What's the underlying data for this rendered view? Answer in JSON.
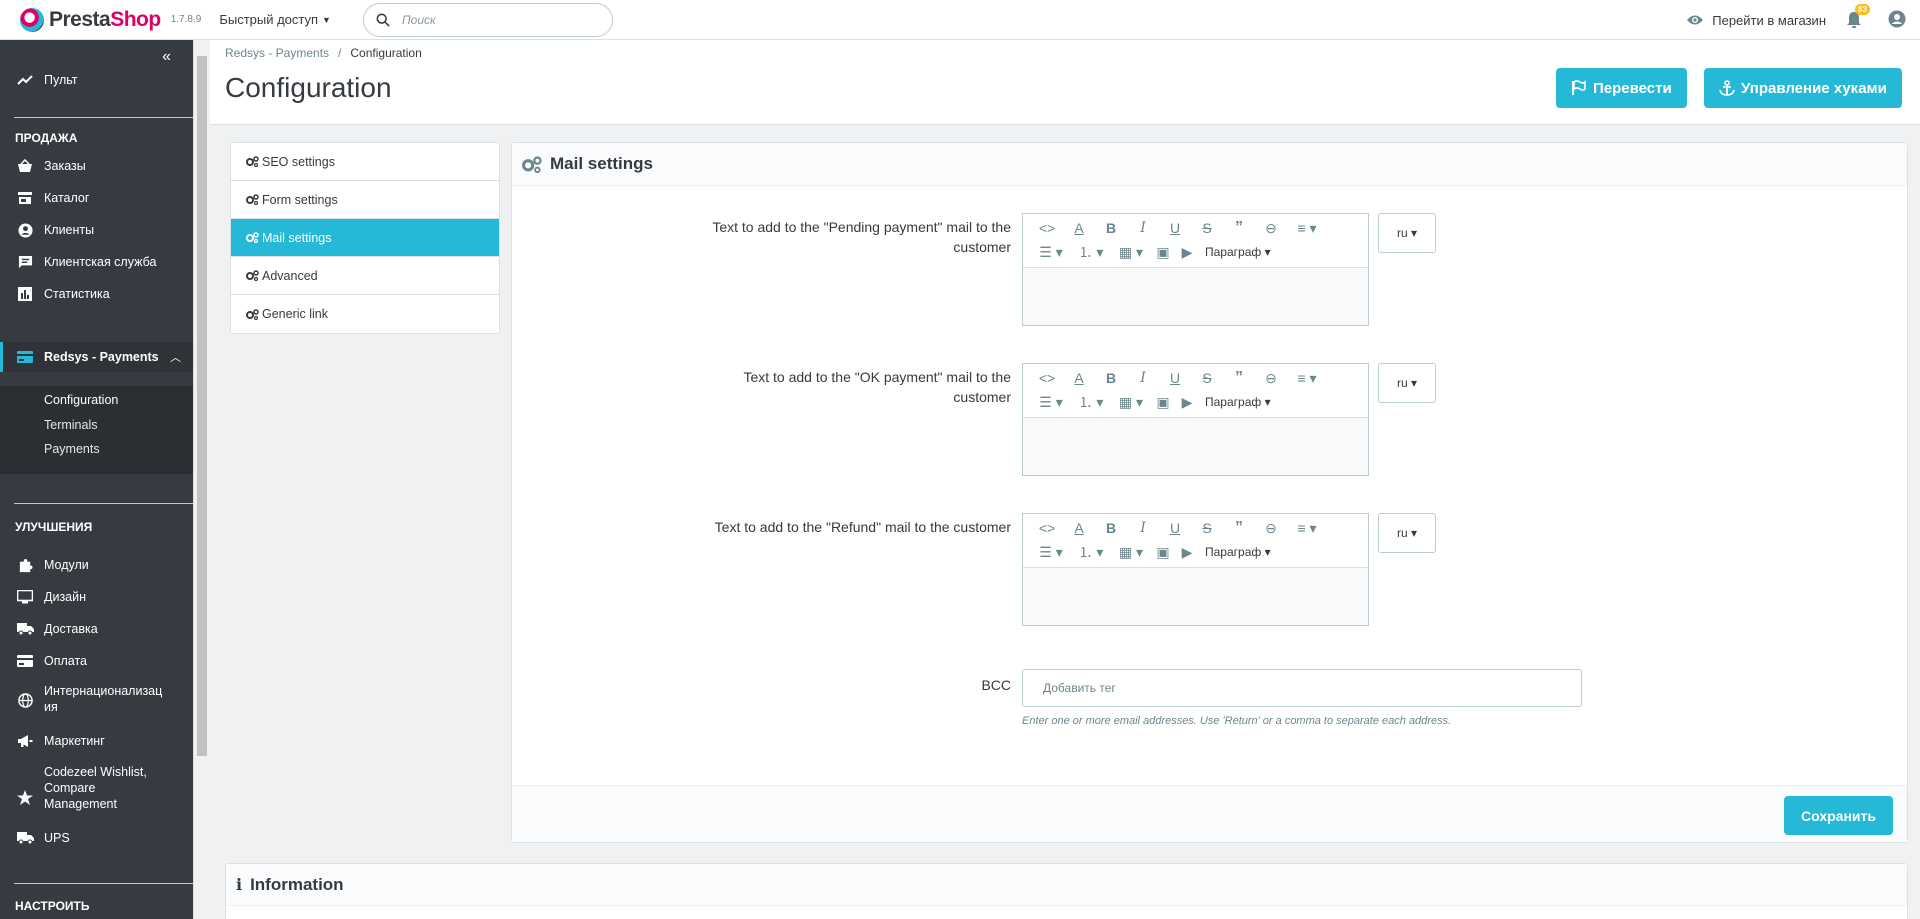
{
  "topbar": {
    "logo_main": "Presta",
    "logo_accent": "Shop",
    "version": "1.7.8.9",
    "quick_access": "Быстрый доступ",
    "search_placeholder": "Поиск",
    "view_shop": "Перейти в магазин",
    "notifications_count": "83"
  },
  "sidebar": {
    "dashboard": "Пульт",
    "section_sell": "ПРОДАЖА",
    "orders": "Заказы",
    "catalog": "Каталог",
    "customers": "Клиенты",
    "customer_service": "Клиентская служба",
    "stats": "Статистика",
    "redsys": "Redsys - Payments",
    "sub_configuration": "Configuration",
    "sub_terminals": "Terminals",
    "sub_payments": "Payments",
    "section_improve": "УЛУЧШЕНИЯ",
    "modules": "Модули",
    "design": "Дизайн",
    "shipping": "Доставка",
    "payment": "Оплата",
    "international_1": "Интернационализац",
    "international_2": "ия",
    "marketing": "Маркетинг",
    "codezeel_1": "Codezeel Wishlist,",
    "codezeel_2": "Compare",
    "codezeel_3": "Management",
    "ups": "UPS",
    "section_configure": "НАСТРОИТЬ"
  },
  "header": {
    "breadcrumb_parent": "Redsys - Payments",
    "breadcrumb_sep": "/",
    "breadcrumb_current": "Configuration",
    "title": "Configuration",
    "translate_btn": "Перевести",
    "hooks_btn": "Управление хуками"
  },
  "tabs": {
    "seo": "SEO settings",
    "form": "Form settings",
    "mail": "Mail settings",
    "advanced": "Advanced",
    "generic": "Generic link"
  },
  "panel": {
    "title": "Mail settings",
    "pending_label_1": "Text to add to the \"Pending payment\" mail to the",
    "pending_label_2": "customer",
    "ok_label_1": "Text to add to the \"OK payment\" mail to the",
    "ok_label_2": "customer",
    "refund_label": "Text to add to the \"Refund\" mail to the customer",
    "lang": "ru",
    "paragraph": "Параграф",
    "bcc_label": "BCC",
    "bcc_placeholder": "Добавить тег",
    "bcc_help": "Enter one or more email addresses. Use 'Return' or a comma to separate each address.",
    "save": "Сохранить"
  },
  "info": {
    "title": "Information"
  },
  "colors": {
    "accent": "#25b9d7",
    "sidebar": "#363a41",
    "brand_pink": "#df0067"
  }
}
